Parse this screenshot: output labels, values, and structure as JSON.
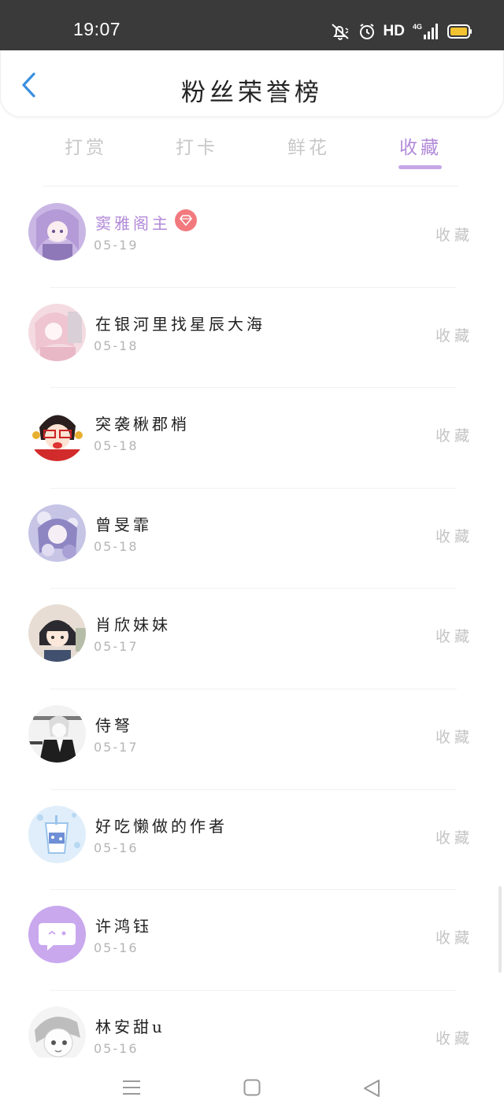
{
  "status_bar": {
    "time": "19:07",
    "network_label": "HD",
    "icons": [
      "mute-icon",
      "alarm-icon",
      "signal-4g-icon",
      "battery-icon"
    ]
  },
  "header": {
    "title": "粉丝荣誉榜",
    "back_icon": "chevron-left-icon"
  },
  "tabs": [
    {
      "label": "打赏",
      "active": false
    },
    {
      "label": "打卡",
      "active": false
    },
    {
      "label": "鲜花",
      "active": false
    },
    {
      "label": "收藏",
      "active": true
    }
  ],
  "fans": [
    {
      "name": "窦雅阁主",
      "date": "05-19",
      "type": "收藏",
      "highlight": true,
      "badge": "diamond-icon"
    },
    {
      "name": "在银河里找星辰大海",
      "date": "05-18",
      "type": "收藏"
    },
    {
      "name": "突袭楸郡梢",
      "date": "05-18",
      "type": "收藏"
    },
    {
      "name": "曾旻霏",
      "date": "05-18",
      "type": "收藏"
    },
    {
      "name": "肖欣妹妹",
      "date": "05-17",
      "type": "收藏"
    },
    {
      "name": "侍弩",
      "date": "05-17",
      "type": "收藏"
    },
    {
      "name": "好吃懒做的作者",
      "date": "05-16",
      "type": "收藏"
    },
    {
      "name": "许鸿钰",
      "date": "05-16",
      "type": "收藏"
    },
    {
      "name": "林安甜u",
      "date": "05-16",
      "type": "收藏"
    }
  ],
  "navbar": {
    "icons": [
      "menu-icon",
      "home-square-icon",
      "back-triangle-icon"
    ]
  },
  "colors": {
    "accent": "#b28ad9",
    "status_bar": "#3a3a3a",
    "badge": "#f27a7f"
  }
}
